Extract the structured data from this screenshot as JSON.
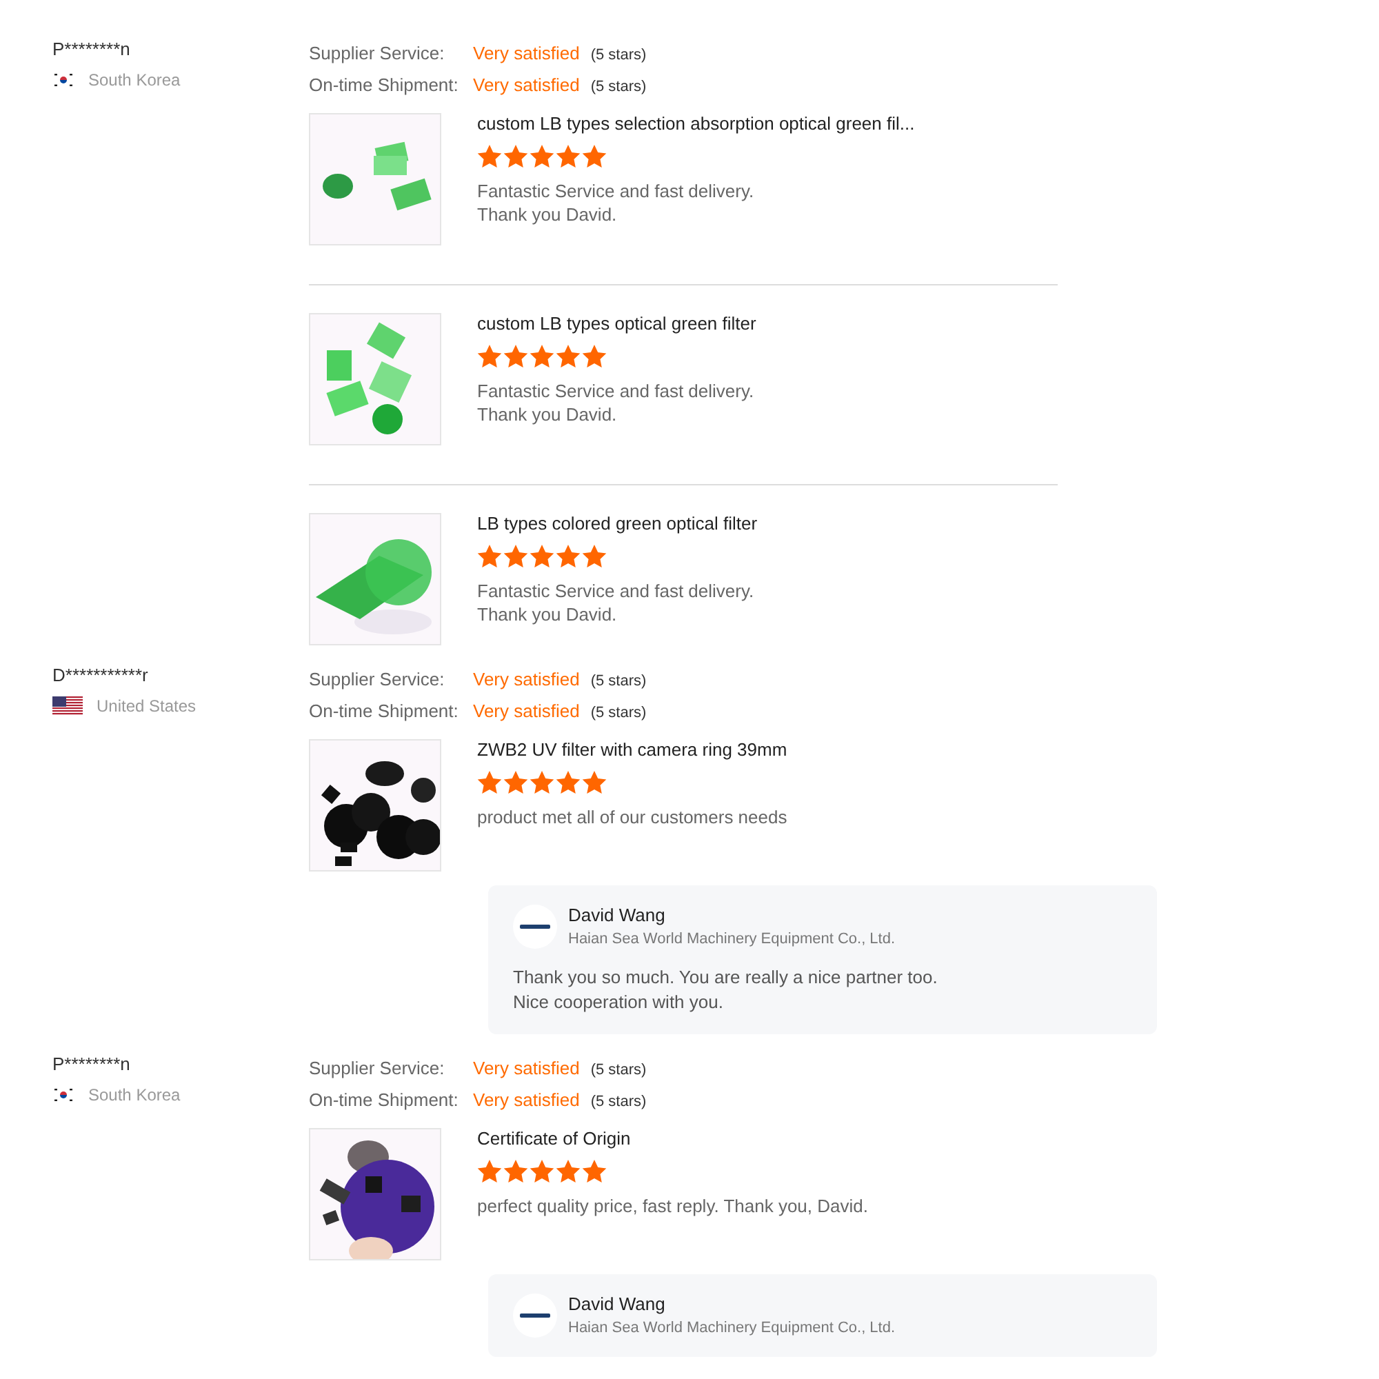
{
  "reviews": [
    {
      "buyer": "P********n",
      "country": "South Korea",
      "flag": {
        "kind": "kr"
      },
      "ratings": [
        {
          "label": "Supplier Service:",
          "value": "Very satisfied",
          "stars_text": "(5 stars)"
        },
        {
          "label": "On-time Shipment:",
          "value": "Very satisfied",
          "stars_text": "(5 stars)"
        }
      ],
      "products": [
        {
          "title": "custom LB types selection absorption optical green fil...",
          "stars": 5,
          "comment": "Fantastic Service and fast delivery.\nThank you David."
        },
        {
          "title": "custom LB types optical green filter",
          "stars": 5,
          "comment": "Fantastic Service and fast delivery.\nThank you David."
        },
        {
          "title": "LB types colored green optical filter",
          "stars": 5,
          "comment": "Fantastic Service and fast delivery.\nThank you David."
        }
      ]
    },
    {
      "buyer": "D***********r",
      "country": "United States",
      "flag": {
        "kind": "us"
      },
      "ratings": [
        {
          "label": "Supplier Service:",
          "value": "Very satisfied",
          "stars_text": "(5 stars)"
        },
        {
          "label": "On-time Shipment:",
          "value": "Very satisfied",
          "stars_text": "(5 stars)"
        }
      ],
      "products": [
        {
          "title": "ZWB2 UV filter with camera ring 39mm",
          "stars": 5,
          "comment": "product met all of our customers needs"
        }
      ],
      "reply": {
        "name": "David Wang",
        "company": "Haian Sea World Machinery Equipment Co., Ltd.",
        "text": "Thank you so much. You are really a nice partner too.\nNice cooperation with you."
      }
    },
    {
      "buyer": "P********n",
      "country": "South Korea",
      "flag": {
        "kind": "kr"
      },
      "ratings": [
        {
          "label": "Supplier Service:",
          "value": "Very satisfied",
          "stars_text": "(5 stars)"
        },
        {
          "label": "On-time Shipment:",
          "value": "Very satisfied",
          "stars_text": "(5 stars)"
        }
      ],
      "products": [
        {
          "title": "Certificate of Origin",
          "stars": 5,
          "comment": "perfect quality price, fast reply. Thank you, David."
        }
      ],
      "reply": {
        "name": "David Wang",
        "company": "Haian Sea World Machinery Equipment Co., Ltd."
      }
    }
  ]
}
